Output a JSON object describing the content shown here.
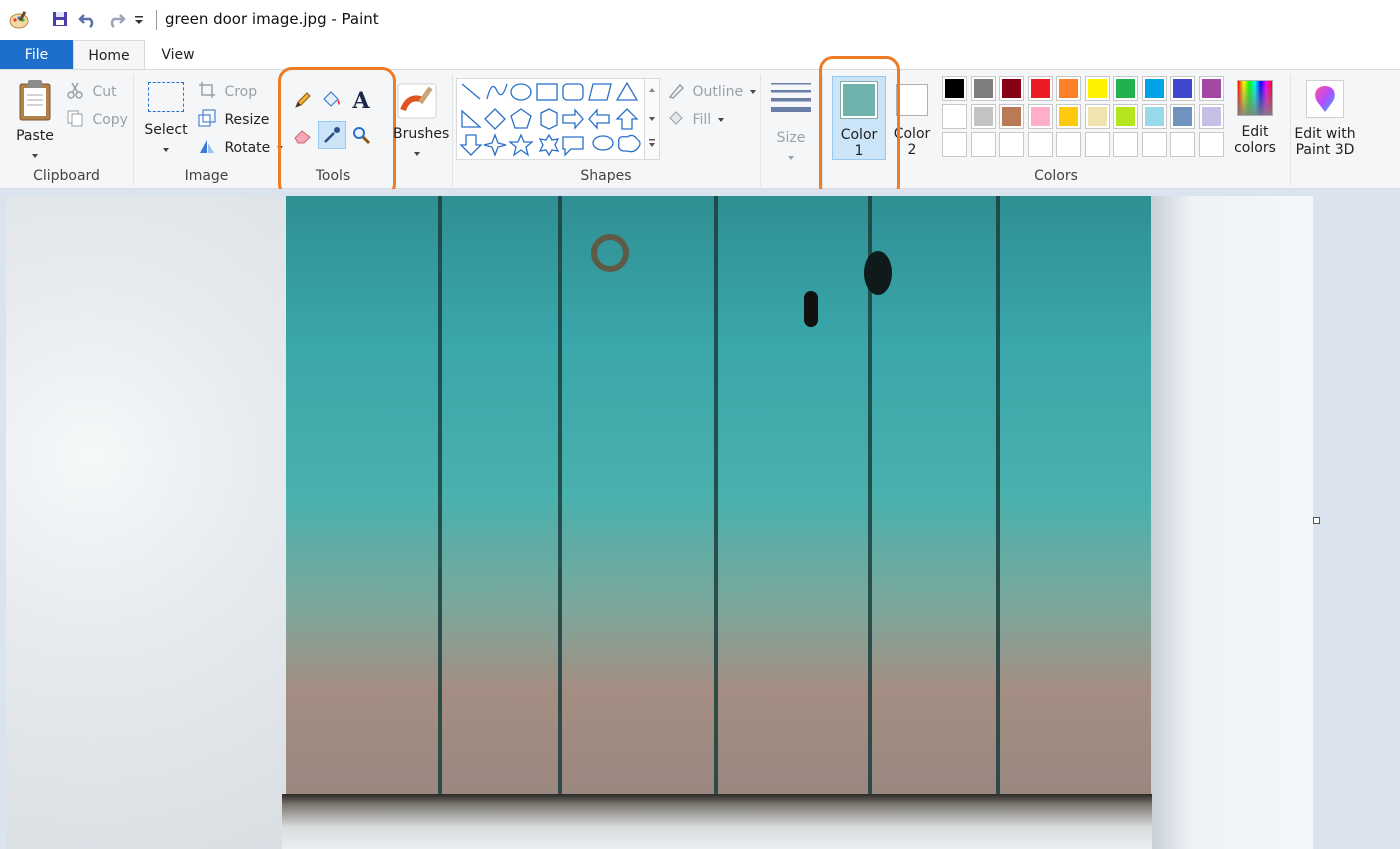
{
  "window": {
    "title": "green door image.jpg - Paint"
  },
  "tabs": [
    {
      "label": "File"
    },
    {
      "label": "Home"
    },
    {
      "label": "View"
    }
  ],
  "ribbon": {
    "clipboard": {
      "group_label": "Clipboard",
      "paste": "Paste",
      "cut": "Cut",
      "copy": "Copy"
    },
    "image": {
      "group_label": "Image",
      "select": "Select",
      "crop": "Crop",
      "resize": "Resize",
      "rotate": "Rotate"
    },
    "tools": {
      "group_label": "Tools"
    },
    "brushes": {
      "label": "Brushes"
    },
    "shapes": {
      "group_label": "Shapes",
      "outline": "Outline",
      "fill": "Fill"
    },
    "size": {
      "label": "Size"
    },
    "colors": {
      "group_label": "Colors",
      "color1_line1": "Color",
      "color1_line2": "1",
      "color2_line1": "Color",
      "color2_line2": "2",
      "color1_value": "#6fb3ac",
      "color2_value": "#ffffff",
      "edit_line1": "Edit",
      "edit_line2": "colors",
      "palette_row1": [
        "#000000",
        "#7f7f7f",
        "#880015",
        "#ed1c24",
        "#ff7f27",
        "#fff200",
        "#22b14c",
        "#00a2e8",
        "#3f48cc",
        "#a349a4"
      ],
      "palette_row2": [
        "#ffffff",
        "#c3c3c3",
        "#b97a57",
        "#ffaec9",
        "#ffc90e",
        "#efe4b0",
        "#b5e61d",
        "#99d9ea",
        "#7092be",
        "#c8bfe7"
      ]
    },
    "paint3d": {
      "line1": "Edit with",
      "line2": "Paint 3D"
    }
  },
  "colors": {
    "accent": "#1e6fc9",
    "highlight": "#f07b25"
  }
}
